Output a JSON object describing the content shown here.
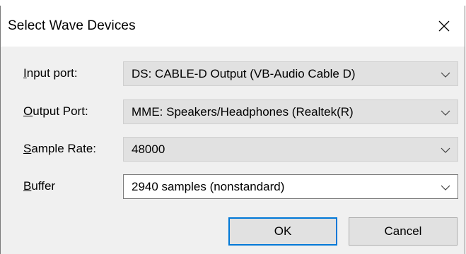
{
  "window": {
    "title": "Select Wave Devices"
  },
  "fields": [
    {
      "label_u": "I",
      "label_rest": "nput port:",
      "value": "DS: CABLE-D Output (VB-Audio Cable D)"
    },
    {
      "label_u": "O",
      "label_rest": "utput Port:",
      "value": "MME: Speakers/Headphones (Realtek(R)"
    },
    {
      "label_u": "S",
      "label_rest": "ample Rate:",
      "value": "48000"
    },
    {
      "label_u": "B",
      "label_rest": "uffer",
      "value": "2940 samples (nonstandard)"
    }
  ],
  "buttons": {
    "ok": "OK",
    "cancel": "Cancel"
  },
  "icons": {
    "close": "close-icon",
    "dropdown": "chevron-down-icon"
  },
  "colors": {
    "dialog_bg": "#f0f0f0",
    "focus_border": "#0078d7"
  }
}
